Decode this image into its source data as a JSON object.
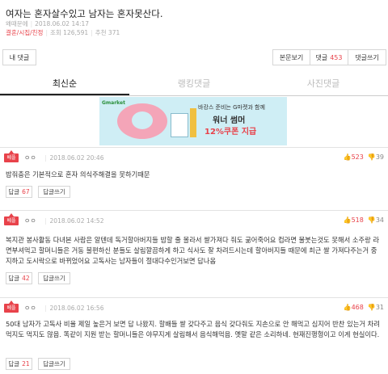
{
  "post": {
    "title": "여자는 혼자살수있고 남자는 혼자못산다.",
    "author": "왜때문에",
    "date": "2018.06.02 14:17",
    "category": "결혼/시집/친정",
    "views": "조회 126,591",
    "recommend": "추천 371"
  },
  "toolbar": {
    "my_comments": "내 댓글",
    "view_post": "본문보기",
    "comments_label": "댓글",
    "comments_count": "453",
    "write_comment": "댓글쓰기"
  },
  "tabs": [
    "최신순",
    "랭킹댓글",
    "사진댓글"
  ],
  "banner": {
    "brand": "Gmarket",
    "line1": "바캉스 준비는 G마켓과 함께",
    "line2": "워너 썸머",
    "line3": "12%쿠폰 지급"
  },
  "comments": [
    {
      "badge": "베플",
      "nick": "ㅇㅇ",
      "date": "2018.06.02 20:46",
      "up": "523",
      "down": "39",
      "text": "밥줘충은 기본적으로 혼자 의식주해결을 못하기때문",
      "reply_label": "답글",
      "reply_count": "67",
      "write_reply": "답글쓰기"
    },
    {
      "badge": "베플",
      "nick": "ㅇㅇ",
      "date": "2018.06.02 14:52",
      "up": "518",
      "down": "34",
      "text": "복지관 봉사활동 다녀본 사람은 알텐데 독거할아버지들 밥할 줄 몰라서 쌀가져다 줘도 굶어죽어요 컵라면 물붓는것도 못해서 소주랑 라면부셔먹고 할머니들은 거동 불편하신 분들도 살림깔끔하게 하고 식사도 잘 차려드시는데 할아버지들 때문에 최근 쌀 가져다주는거 중지하고 도시락으로 바뀌었어요 고독사는 남자들이 절대다수인거보면 답나옴",
      "reply_label": "답글",
      "reply_count": "42",
      "write_reply": "답글쓰기"
    },
    {
      "badge": "베플",
      "nick": "ㅇㅇ",
      "date": "2018.06.02 16:56",
      "up": "468",
      "down": "31",
      "text": "50대 남자가 고독사 비율 제일 높은거 보면 답 나왔지. 할배들 쌀 갖다주고 음식 갖다줘도 지손으로 안 해먹고 심지어 반찬 있는거 차려먹지도 먹지도 않음. 똑같이 지원 받는 할머니들은 야무지게 살림해서 음식해먹음. 옛말 같은 소리하네. 현재진행형이고 이게 현실이다.",
      "reply_label": "답글",
      "reply_count": "21",
      "write_reply": "답글쓰기"
    }
  ]
}
